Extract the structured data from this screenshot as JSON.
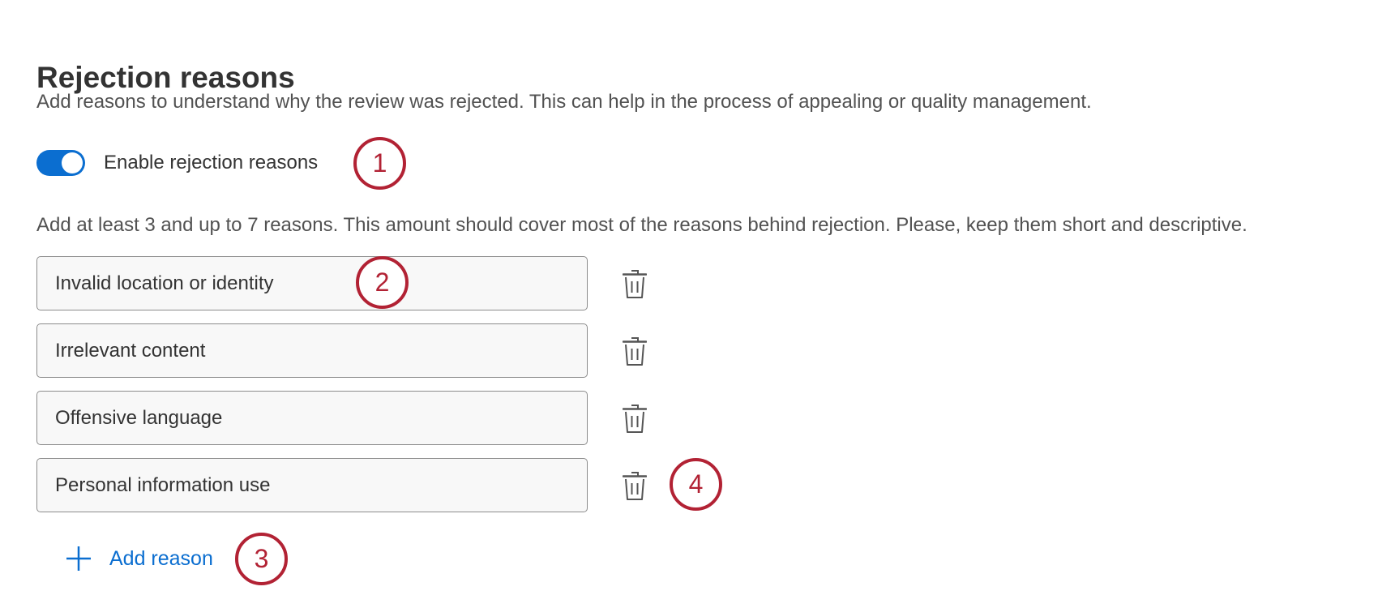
{
  "section": {
    "title": "Rejection reasons",
    "description": "Add reasons to understand why the review was rejected. This can help in the process of appealing or quality management."
  },
  "toggle": {
    "label": "Enable rejection reasons",
    "enabled": true,
    "accent_color": "#0b6ed0"
  },
  "hint": "Add at least 3 and up to 7 reasons. This amount should cover most of the reasons behind rejection. Please, keep them short and descriptive.",
  "reasons": [
    {
      "value": "Invalid location or identity"
    },
    {
      "value": "Irrelevant content"
    },
    {
      "value": "Offensive language"
    },
    {
      "value": "Personal information use"
    }
  ],
  "add_button": {
    "label": "Add reason",
    "icon": "plus-icon"
  },
  "row_action_icon": "trash-icon",
  "callouts": [
    "1",
    "2",
    "3",
    "4"
  ],
  "colors": {
    "link": "#0b6ed0",
    "callout": "#b22234"
  }
}
